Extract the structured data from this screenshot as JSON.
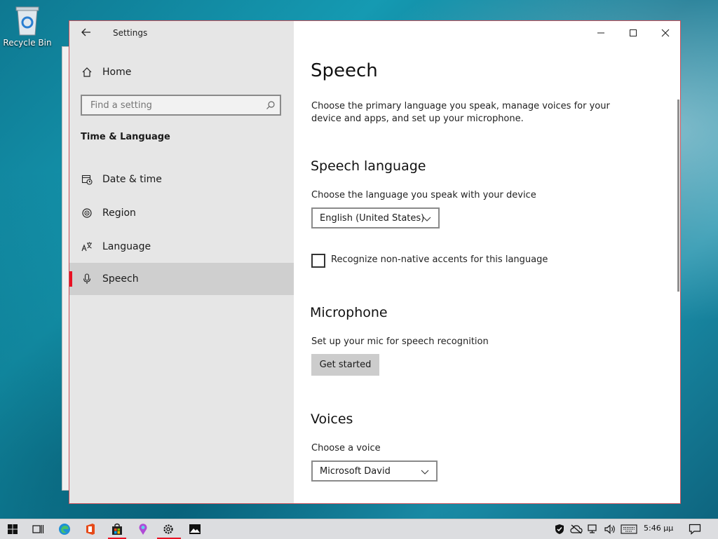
{
  "desktop": {
    "recycle_bin_label": "Recycle Bin"
  },
  "window": {
    "title": "Settings",
    "search_placeholder": "Find a setting",
    "home_label": "Home",
    "section_title": "Time & Language",
    "nav": [
      {
        "label": "Date & time",
        "icon": "calendar-clock-icon"
      },
      {
        "label": "Region",
        "icon": "globe-icon"
      },
      {
        "label": "Language",
        "icon": "language-icon"
      },
      {
        "label": "Speech",
        "icon": "microphone-icon",
        "selected": true
      }
    ]
  },
  "main": {
    "title": "Speech",
    "intro": "Choose the primary language you speak, manage voices for your device and apps, and set up your microphone.",
    "speech_language": {
      "heading": "Speech language",
      "prompt": "Choose the language you speak with your device",
      "selected": "English (United States)",
      "checkbox_label": "Recognize non-native accents for this language",
      "checkbox_checked": false
    },
    "microphone": {
      "heading": "Microphone",
      "prompt": "Set up your mic for speech recognition",
      "button": "Get started"
    },
    "voices": {
      "heading": "Voices",
      "prompt": "Choose a voice",
      "selected": "Microsoft David"
    }
  },
  "taskbar": {
    "time": "5:46 μμ"
  },
  "colors": {
    "accent": "#e81123",
    "window_border": "#c7505a",
    "nav_bg": "#e6e6e6",
    "selected_bg": "#cfcfcf"
  }
}
